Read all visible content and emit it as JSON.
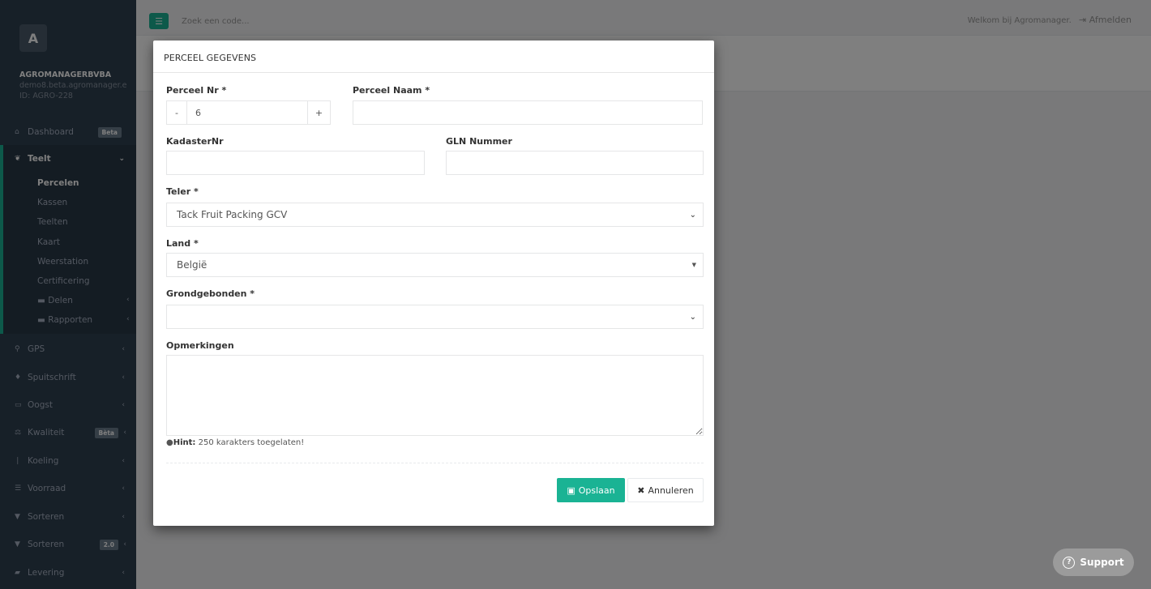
{
  "sidebar": {
    "avatar_letter": "A",
    "company": "AGROMANAGERBVBA",
    "domain": "demo8.beta.agromanager.e",
    "id_text": "ID: AGRO-228",
    "dashboard": {
      "label": "Dashboard",
      "badge": "Beta"
    },
    "teelt": {
      "label": "Teelt"
    },
    "teelt_items": [
      "Percelen",
      "Kassen",
      "Teelten",
      "Kaart",
      "Weerstation",
      "Certificering"
    ],
    "delen": "Delen",
    "rapporten": "Rapporten",
    "gps": "GPS",
    "spuitschrift": "Spuitschrift",
    "oogst": "Oogst",
    "kwaliteit": {
      "label": "Kwaliteit",
      "badge": "Bèta"
    },
    "koeling": "Koeling",
    "voorraad": "Voorraad",
    "sorteren": "Sorteren",
    "sorteren2": {
      "label": "Sorteren",
      "badge": "2.0"
    },
    "levering": "Levering"
  },
  "topbar": {
    "search_placeholder": "Zoek een code...",
    "welcome": "Welkom bij Agromanager.",
    "logout": "Afmelden"
  },
  "modal": {
    "title": "PERCEEL GEGEVENS",
    "perceel_nr_label": "Perceel Nr *",
    "perceel_nr_value": "6",
    "minus": "-",
    "plus": "+",
    "perceel_naam_label": "Perceel Naam *",
    "kadaster_label": "KadasterNr",
    "gln_label": "GLN Nummer",
    "teler_label": "Teler *",
    "teler_value": "Tack Fruit Packing GCV",
    "land_label": "Land *",
    "land_value": "België",
    "grond_label": "Grondgebonden *",
    "opmerkingen_label": "Opmerkingen",
    "hint_bold": "Hint:",
    "hint_text": " 250 karakters toegelaten!",
    "save": "Opslaan",
    "cancel": "Annuleren"
  },
  "support": "Support"
}
